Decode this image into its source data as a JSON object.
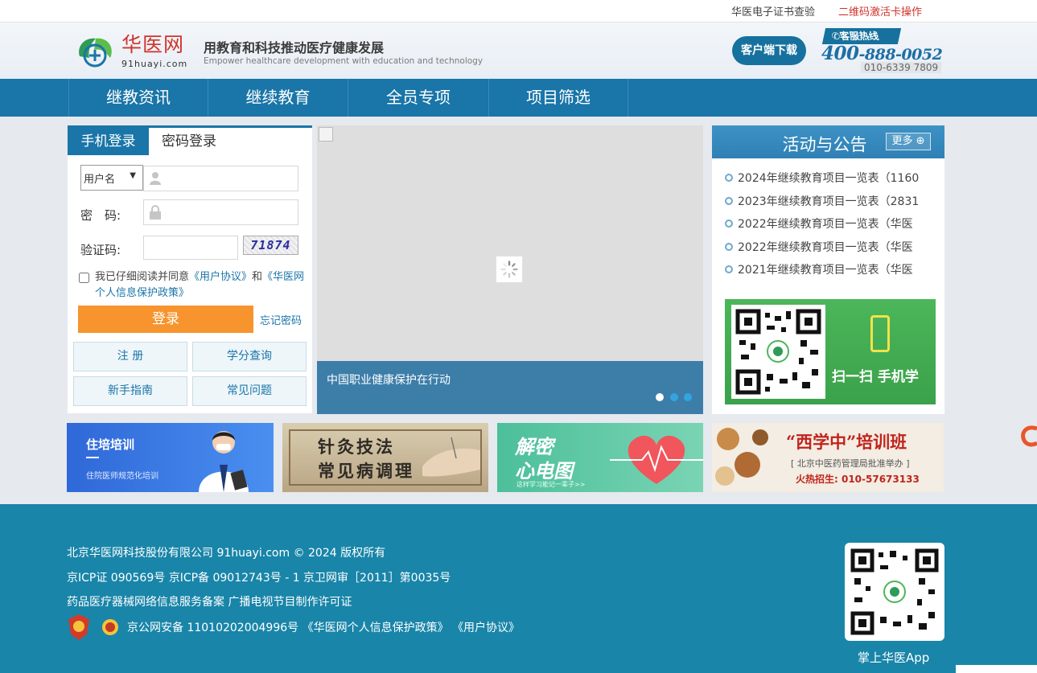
{
  "topbar": {
    "cert_check": "华医电子证书查验",
    "qr_activate": "二维码激活卡操作"
  },
  "header": {
    "brand": "华医网",
    "brand_url": "91huayi.com",
    "slogan": "用教育和科技推动医疗健康发展",
    "slogan_en": "Empower healthcare development with education and technology",
    "download_label": "客户端下载",
    "hotline_label": "客服热线",
    "hotline_prefix": "400",
    "hotline_rest": "-888-0052",
    "hotline_alt": "010-6339 7809"
  },
  "nav": {
    "items": [
      "继教资讯",
      "继续教育",
      "全员专项",
      "项目筛选"
    ]
  },
  "login": {
    "tab_phone": "手机登录",
    "tab_password": "密码登录",
    "account_type": "用户名",
    "password_label": "密　码:",
    "captcha_label": "验证码:",
    "captcha_code": "71874",
    "agree_prefix": "我已仔细阅读并同意",
    "agree_user": "《用户协议》",
    "agree_and": "和",
    "agree_privacy": "《华医网个人信息保护政策》",
    "login_label": "登录",
    "forgot_label": "忘记密码",
    "register": "注 册",
    "credit_query": "学分查询",
    "guide": "新手指南",
    "faq": "常见问题"
  },
  "banner": {
    "caption": "中国职业健康保护在行动",
    "slide_count": 3,
    "active_slide": 1
  },
  "announcements": {
    "title": "活动与公告",
    "more_label": "更多",
    "items": [
      "2024年继续教育项目一览表（1160",
      "2023年继续教育项目一览表（2831",
      "2022年继续教育项目一览表（华医",
      "2022年继续教育项目一览表（华医",
      "2021年继续教育项目一览表（华医"
    ],
    "qr_caption": "扫一扫 手机学"
  },
  "promos": {
    "p1_title": "住培培训",
    "p1_sub": "住院医师规范化培训",
    "p2_line1": "针灸技法",
    "p2_line2": "常见病调理",
    "p3_line1": "解密",
    "p3_line2": "心电图",
    "p3_sub": "这样学习能记一辈子>>",
    "p4_title": "“西学中”培训班",
    "p4_sub": "[ 北京中医药管理局批准举办 ]",
    "p4_phone": "火热招生: 010-57673133"
  },
  "footer": {
    "line1": "北京华医网科技股份有限公司 91huayi.com © 2024 版权所有",
    "line2": "京ICP证 090569号 京ICP备 09012743号 - 1 京卫网审［2011］第0035号",
    "line3": "药品医疗器械网络信息服务备案 广播电视节目制作许可证",
    "line4_prefix": "京公网安备 11010202004996号",
    "privacy_link": "《华医网个人信息保护政策》",
    "user_link": "《用户协议》",
    "app_label": "掌上华医App"
  },
  "colors": {
    "primary": "#1a75a8",
    "accent_orange": "#f7942e",
    "brand_red": "#d0342c",
    "footer": "#1985a9"
  }
}
